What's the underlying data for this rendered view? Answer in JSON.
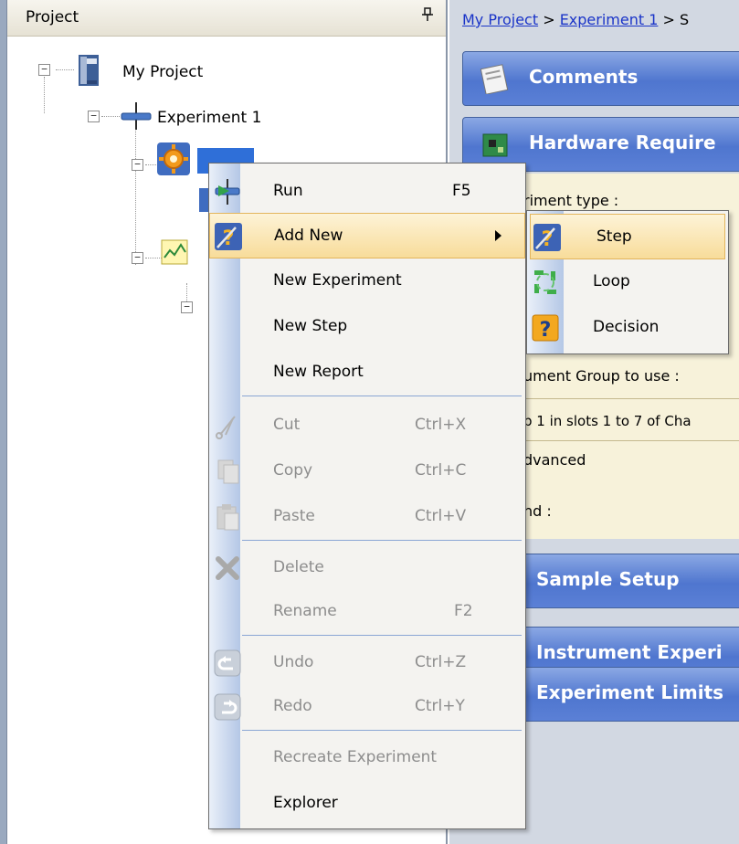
{
  "project_panel": {
    "title": "Project",
    "pin_glyph": "ᕷ"
  },
  "tree": {
    "root": "My Project",
    "experiment": "Experiment 1"
  },
  "breadcrumb": {
    "part1": "My Project",
    "sep1": " > ",
    "part2": "Experiment 1",
    "sep2": " > S"
  },
  "sections": {
    "comments": "Comments",
    "hardware": "Hardware Require",
    "sample_setup": "Sample Setup",
    "instrument": "Instrument Experi",
    "limits": "Experiment Limits"
  },
  "hardware": {
    "exp_type": "riment type :",
    "group_to_use": "ument Group to use :",
    "slots": "p 1 in slots 1 to 7 of Cha",
    "advanced": "dvanced",
    "nd": "nd :"
  },
  "context_menu": {
    "run": {
      "label": "Run",
      "shortcut": "F5"
    },
    "add_new": {
      "label": "Add New"
    },
    "new_experiment": {
      "label": "New Experiment"
    },
    "new_step": {
      "label": "New Step"
    },
    "new_report": {
      "label": "New Report"
    },
    "cut": {
      "label": "Cut",
      "shortcut": "Ctrl+X"
    },
    "copy": {
      "label": "Copy",
      "shortcut": "Ctrl+C"
    },
    "paste": {
      "label": "Paste",
      "shortcut": "Ctrl+V"
    },
    "delete": {
      "label": "Delete"
    },
    "rename": {
      "label": "Rename",
      "shortcut": "F2"
    },
    "undo": {
      "label": "Undo",
      "shortcut": "Ctrl+Z"
    },
    "redo": {
      "label": "Redo",
      "shortcut": "Ctrl+Y"
    },
    "recreate": {
      "label": "Recreate Experiment"
    },
    "explorer": {
      "label": "Explorer"
    }
  },
  "submenu": {
    "step": "Step",
    "loop": "Loop",
    "decision": "Decision"
  },
  "colors": {
    "link": "#1a34c8",
    "section_bar": "#4f76cf",
    "menu_highlight": "#f8dc9a",
    "disabled_text": "#8d8d8d"
  }
}
